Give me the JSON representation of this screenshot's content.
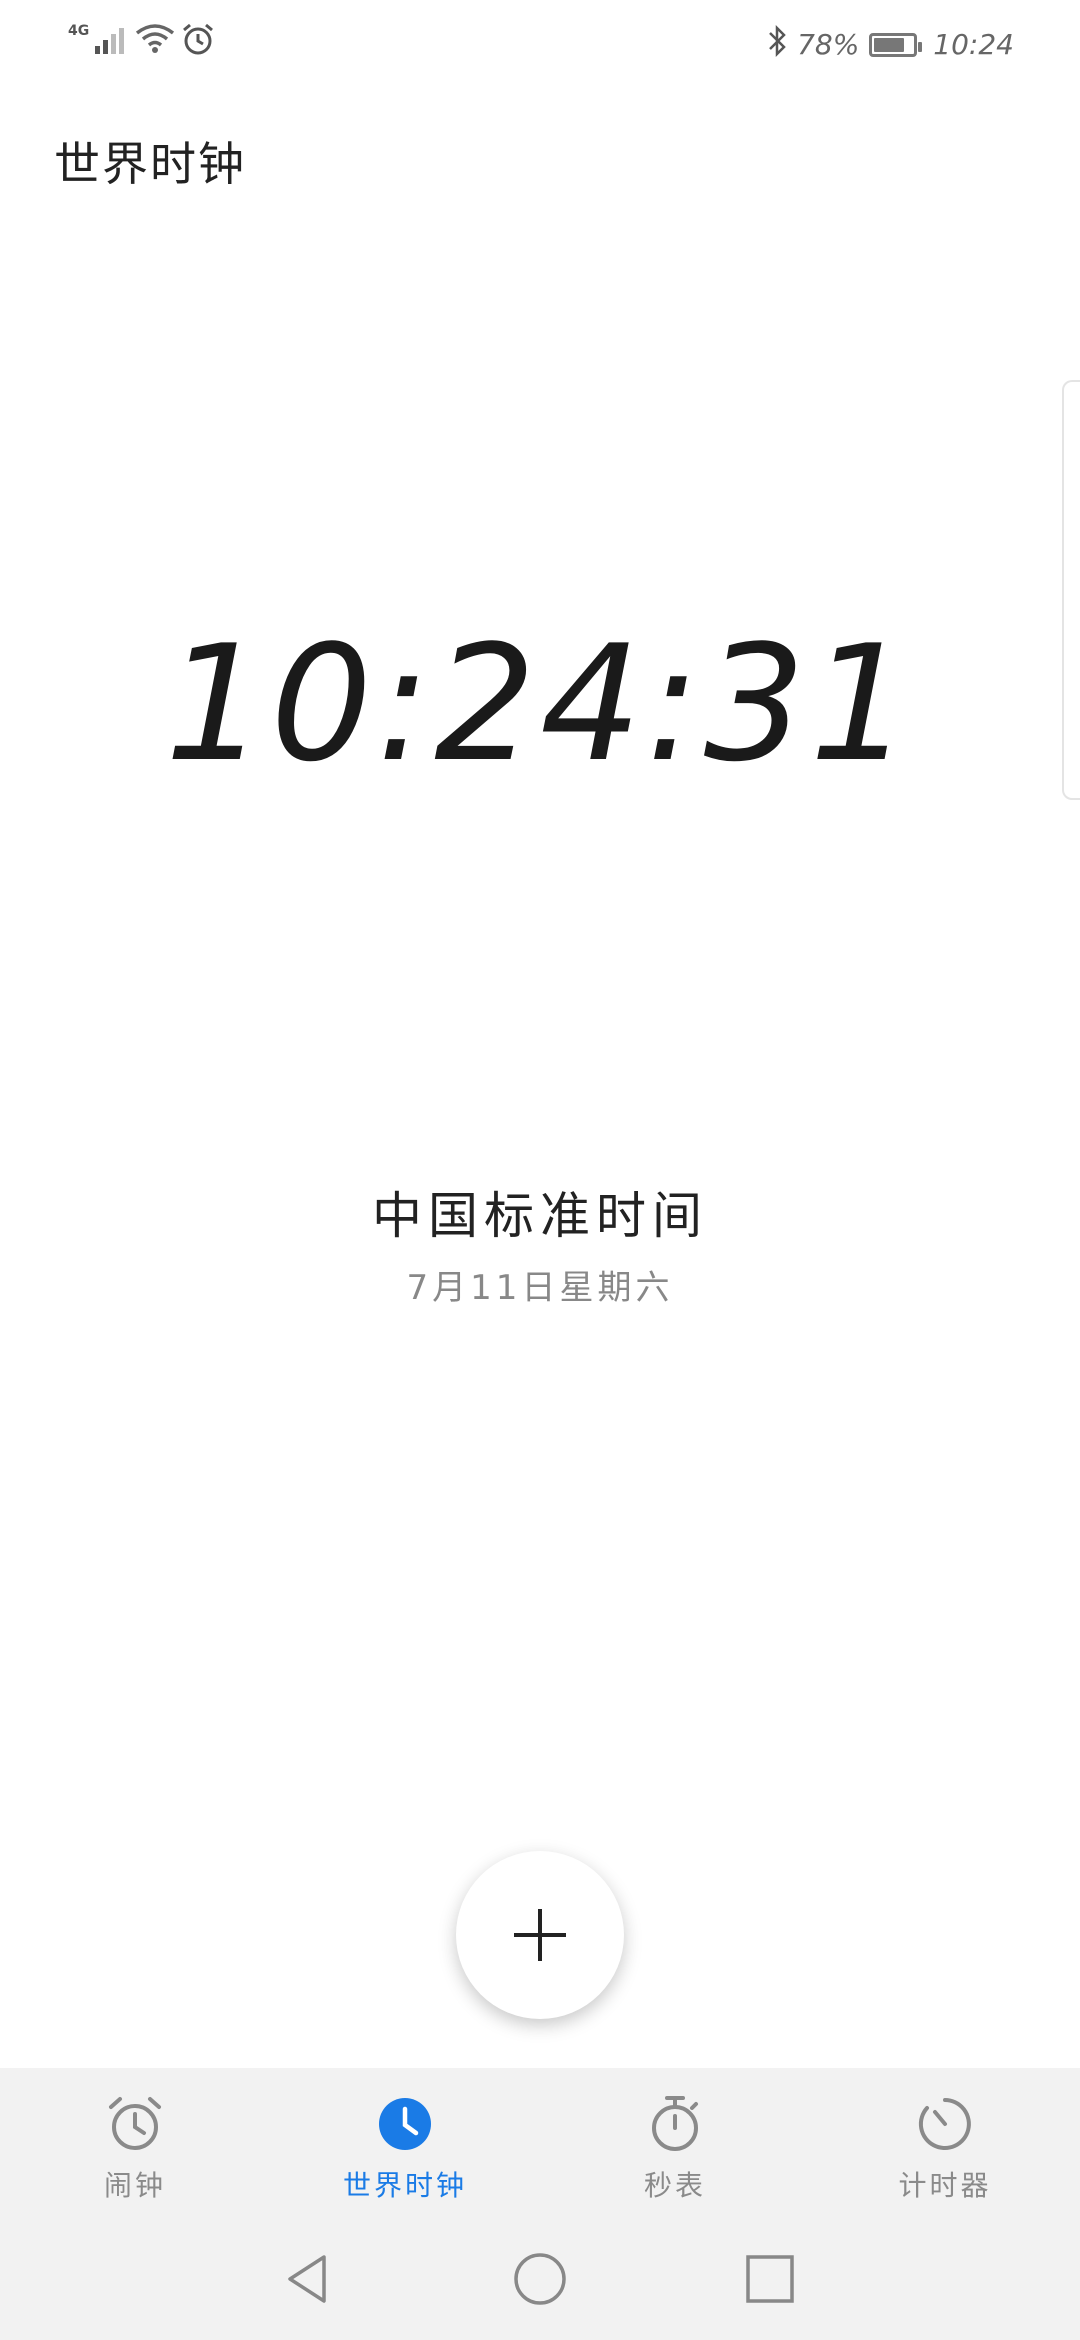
{
  "status_bar": {
    "network_type": "4G",
    "battery_percent": "78%",
    "battery_level": 0.78,
    "time": "10:24",
    "icons": [
      "signal-icon",
      "wifi-icon",
      "alarm-icon",
      "bluetooth-icon",
      "battery-icon"
    ]
  },
  "header": {
    "title": "世界时钟"
  },
  "clock": {
    "time": "10:24:31",
    "timezone": "中国标准时间",
    "date": "7月11日星期六"
  },
  "fab": {
    "icon": "plus-icon"
  },
  "tabs": [
    {
      "label": "闹钟",
      "icon": "alarm-clock-icon",
      "active": false
    },
    {
      "label": "世界时钟",
      "icon": "world-clock-icon",
      "active": true
    },
    {
      "label": "秒表",
      "icon": "stopwatch-icon",
      "active": false
    },
    {
      "label": "计时器",
      "icon": "timer-icon",
      "active": false
    }
  ],
  "nav_bar": {
    "buttons": [
      "back-icon",
      "home-icon",
      "recents-icon"
    ]
  },
  "colors": {
    "accent": "#1a7be6",
    "tab_bar_bg": "#f2f2f2",
    "inactive_tab": "#8a8a8a"
  }
}
